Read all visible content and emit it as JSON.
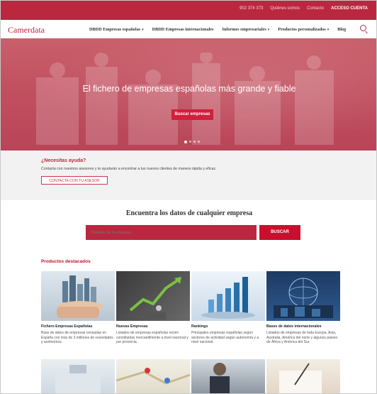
{
  "topbar": {
    "links": [
      "902 374 373",
      "Quiénes somos",
      "Contacto",
      "ACCESO CUENTA"
    ]
  },
  "nav": {
    "logo": "Camerdata",
    "items": [
      {
        "label": "DBDD Empresas españolas",
        "caret": "▾"
      },
      {
        "label": "DBDD Empresas internacionales",
        "caret": ""
      },
      {
        "label": "Informes empresariales",
        "caret": "▾"
      },
      {
        "label": "Productos personalizados",
        "caret": "▾"
      },
      {
        "label": "Blog",
        "caret": ""
      }
    ]
  },
  "hero": {
    "title": "El fichero de empresas españolas más grande y fiable",
    "button": "Buscar empresas",
    "slides": 4,
    "active_slide": 0
  },
  "help": {
    "title": "¿Necesitas ayuda?",
    "text": "Contacta con nuestros asesores y te ayudarán a encontrar a tus nuevos clientes de manera rápida y eficaz.",
    "button": "CONTACTA CON TU ASESOR"
  },
  "search": {
    "title": "Encuentra los datos de cualquier empresa",
    "placeholder": "Nombre de la empresa",
    "button": "BUSCAR"
  },
  "products": {
    "heading": "Productos destacados",
    "cards": [
      {
        "title": "Fichero Empresas Españolas",
        "desc": "Base de datos de empresas censadas en España con más de 3 millones de sociedades y autónomos."
      },
      {
        "title": "Nuevas Empresas",
        "desc": "Listados de empresas españolas recién constituidas mercantilmente a nivel nacional y por provincia."
      },
      {
        "title": "Rankings",
        "desc": "Principales empresas españolas según sectores de actividad según autonomía y a nivel nacional."
      },
      {
        "title": "Bases de datos internacionales",
        "desc": "Listados de empresas de toda Europa, Asia, Australia, América del norte y algunos países de África y América del Sur."
      }
    ]
  },
  "colors": {
    "brand": "#b9283f",
    "accent": "#c8102e"
  }
}
